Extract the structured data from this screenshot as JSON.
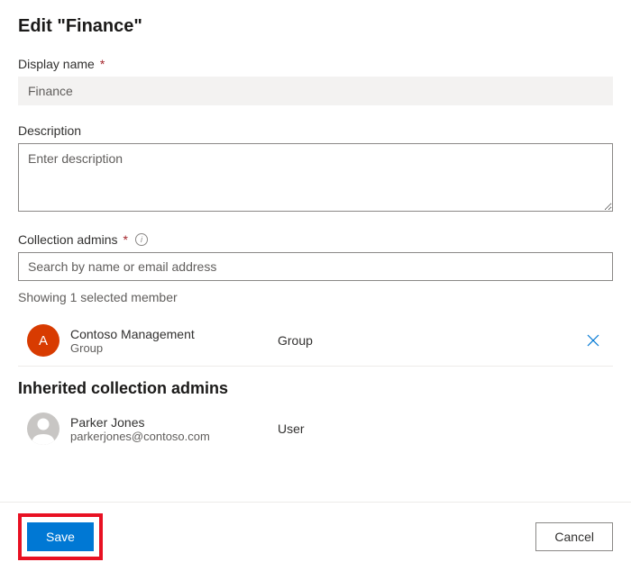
{
  "title": "Edit \"Finance\"",
  "displayName": {
    "label": "Display name",
    "value": "Finance"
  },
  "description": {
    "label": "Description",
    "placeholder": "Enter description"
  },
  "collectionAdmins": {
    "label": "Collection admins",
    "placeholder": "Search by name or email address",
    "showing": "Showing 1 selected member",
    "members": [
      {
        "initial": "A",
        "name": "Contoso Management",
        "sub": "Group",
        "type": "Group"
      }
    ]
  },
  "inherited": {
    "heading": "Inherited collection admins",
    "members": [
      {
        "name": "Parker Jones",
        "sub": "parkerjones@contoso.com",
        "type": "User"
      }
    ]
  },
  "buttons": {
    "save": "Save",
    "cancel": "Cancel"
  }
}
